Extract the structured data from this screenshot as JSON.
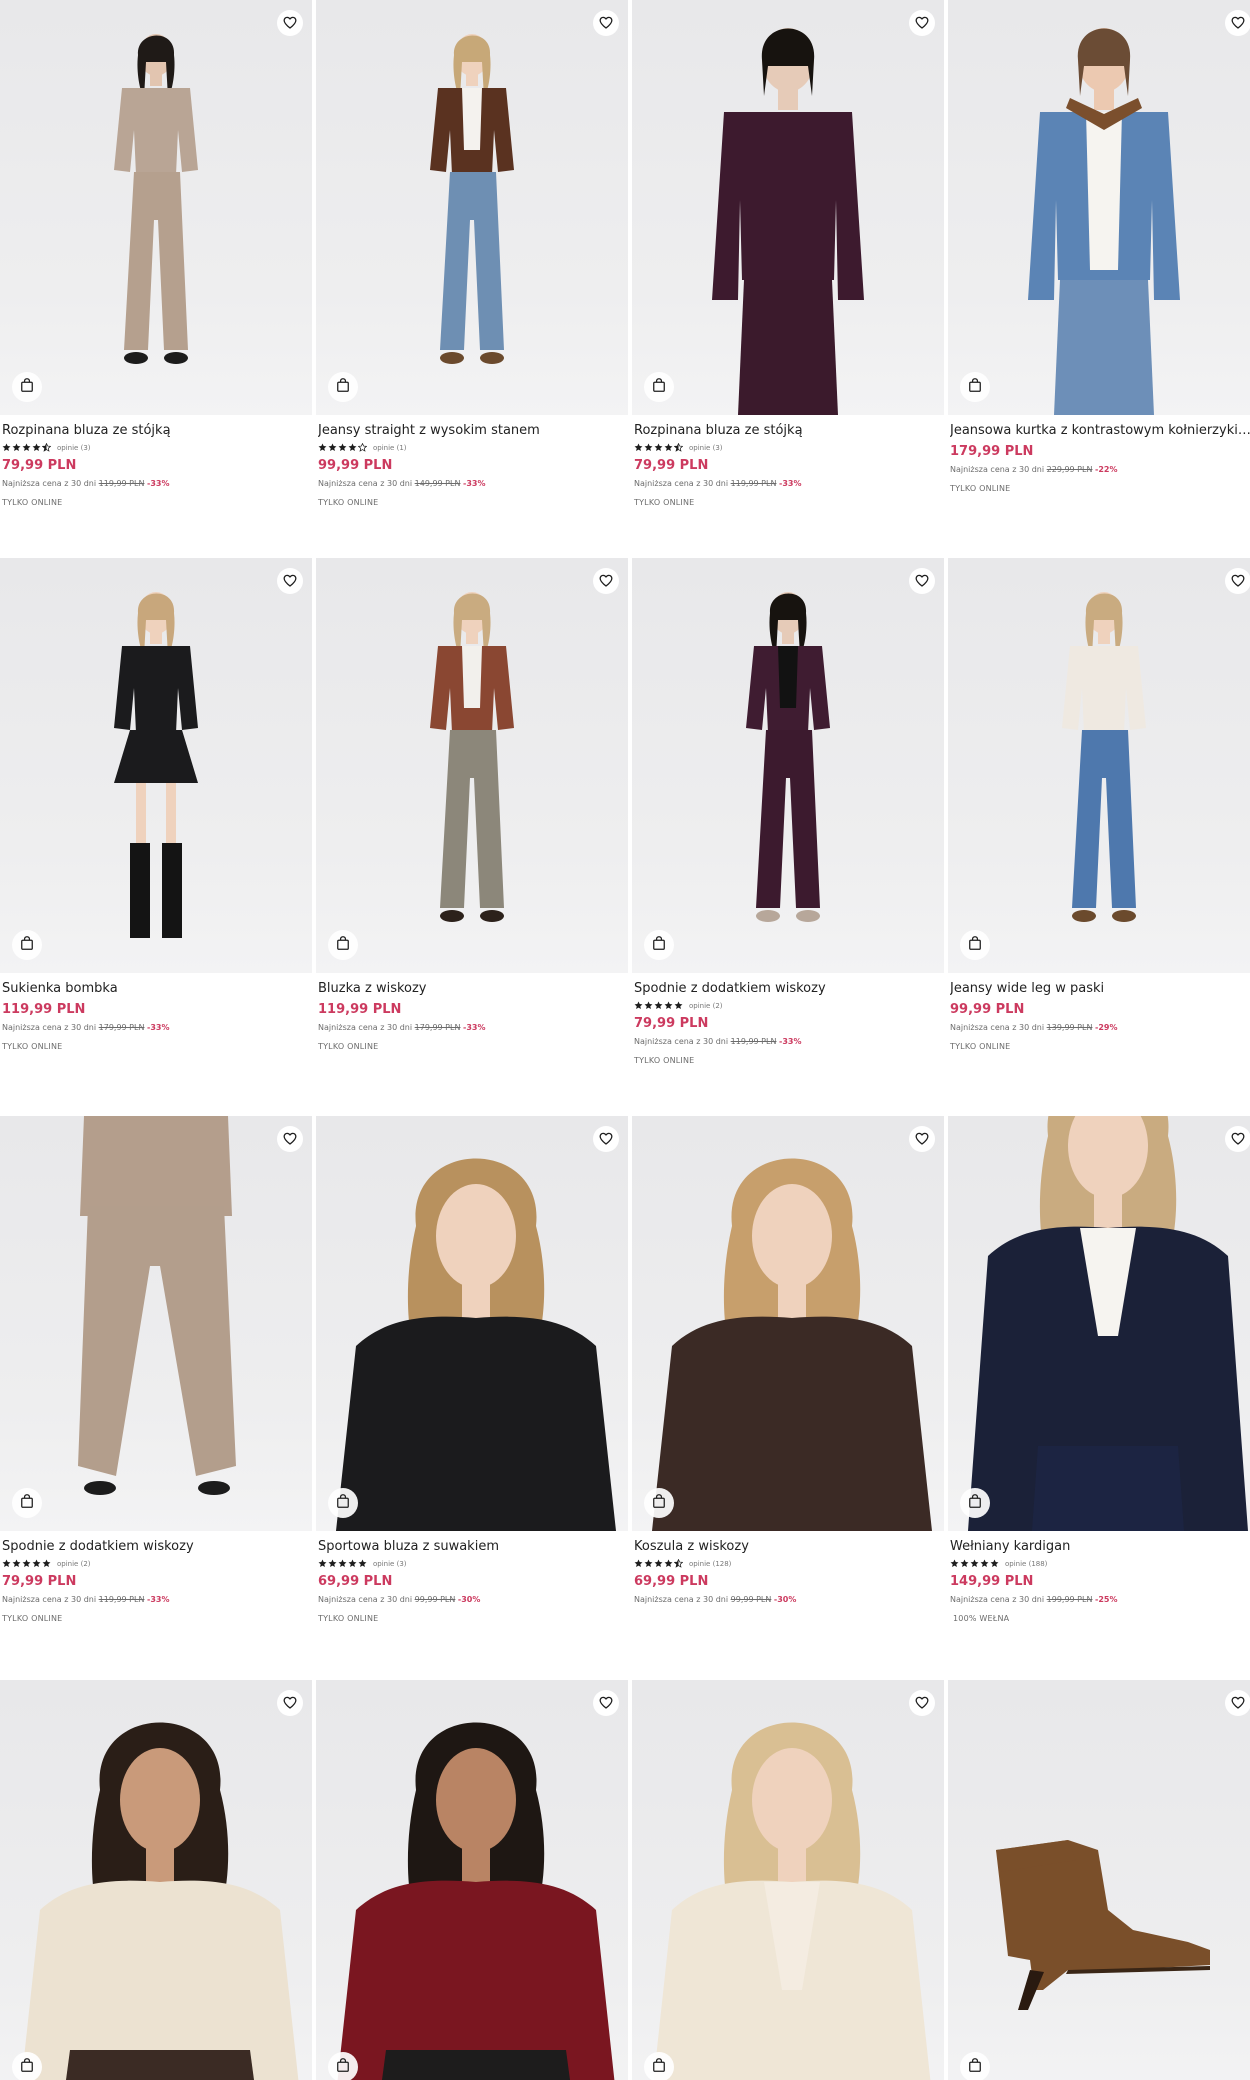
{
  "icons": {
    "favorite": "heart-outline-icon",
    "add_to_bag": "shopping-bag-icon",
    "star_full": "star-filled-icon",
    "star_half": "star-half-icon",
    "star_empty": "star-outline-icon"
  },
  "colors": {
    "price": "#cc3a5f",
    "star": "#1e1e1e",
    "background": "#ffffff"
  },
  "labels": {
    "lowest_prefix": "Najniższa cena z 30 dni"
  },
  "rows": [
    {
      "products": [
        {
          "name": "Rozpinana bluza ze stójką",
          "rating": 4.5,
          "reviews": "opinie (3)",
          "price": "79,99 PLN",
          "old_price": "119,99 PLN",
          "discount": "-33%",
          "badge": "TYLKO ONLINE",
          "image": "model-beige-zip-set"
        },
        {
          "name": "Jeansy straight z wysokim stanem",
          "rating": 4,
          "reviews": "opinie (1)",
          "price": "99,99 PLN",
          "old_price": "149,99 PLN",
          "discount": "-33%",
          "badge": "TYLKO ONLINE",
          "image": "model-brown-jacket-jeans"
        },
        {
          "name": "Rozpinana bluza ze stójką",
          "rating": 4.5,
          "reviews": "opinie (3)",
          "price": "79,99 PLN",
          "old_price": "119,99 PLN",
          "discount": "-33%",
          "badge": "TYLKO ONLINE",
          "image": "model-plum-zip-set"
        },
        {
          "name": "Jeansowa kurtka z kontrastowym kołnierzykiem",
          "rating": null,
          "reviews": "",
          "price": "179,99 PLN",
          "old_price": "229,99 PLN",
          "discount": "-22%",
          "badge": "TYLKO ONLINE",
          "image": "model-denim-jacket"
        }
      ]
    },
    {
      "products": [
        {
          "name": "Sukienka bombka",
          "rating": null,
          "reviews": "",
          "price": "119,99 PLN",
          "old_price": "179,99 PLN",
          "discount": "-33%",
          "badge": "TYLKO ONLINE",
          "image": "model-black-dress"
        },
        {
          "name": "Bluzka z wiskozy",
          "rating": null,
          "reviews": "",
          "price": "119,99 PLN",
          "old_price": "179,99 PLN",
          "discount": "-33%",
          "badge": "TYLKO ONLINE",
          "image": "model-rust-blouse"
        },
        {
          "name": "Spodnie z dodatkiem wiskozy",
          "rating": 5,
          "reviews": "opinie (2)",
          "price": "79,99 PLN",
          "old_price": "119,99 PLN",
          "discount": "-33%",
          "badge": "TYLKO ONLINE",
          "image": "model-plum-trousers"
        },
        {
          "name": "Jeansy wide leg w paski",
          "rating": null,
          "reviews": "",
          "price": "99,99 PLN",
          "old_price": "139,99 PLN",
          "discount": "-29%",
          "badge": "TYLKO ONLINE",
          "image": "model-wide-leg-jeans"
        }
      ]
    },
    {
      "products": [
        {
          "name": "Spodnie z dodatkiem wiskozy",
          "rating": 5,
          "reviews": "opinie (2)",
          "price": "79,99 PLN",
          "old_price": "119,99 PLN",
          "discount": "-33%",
          "badge": "TYLKO ONLINE",
          "image": "model-beige-trousers"
        },
        {
          "name": "Sportowa bluza z suwakiem",
          "rating": 5,
          "reviews": "opinie (3)",
          "price": "69,99 PLN",
          "old_price": "99,99 PLN",
          "discount": "-30%",
          "badge": "TYLKO ONLINE",
          "image": "model-black-track-top"
        },
        {
          "name": "Koszula z wiskozy",
          "rating": 4.5,
          "reviews": "opinie (128)",
          "price": "69,99 PLN",
          "old_price": "99,99 PLN",
          "discount": "-30%",
          "badge": "",
          "image": "model-brown-shirt"
        },
        {
          "name": "Wełniany kardigan",
          "rating": 5,
          "reviews": "opinie (188)",
          "price": "149,99 PLN",
          "old_price": "199,99 PLN",
          "discount": "-25%",
          "badge": "100% WEŁNA",
          "image": "model-navy-cardigan"
        }
      ]
    },
    {
      "products": [
        {
          "name": "",
          "image": "model-cream-half-zip"
        },
        {
          "name": "",
          "image": "model-burgundy-half-zip"
        },
        {
          "name": "",
          "image": "model-cream-cardigan"
        },
        {
          "name": "",
          "image": "suede-ankle-boot"
        }
      ]
    }
  ]
}
